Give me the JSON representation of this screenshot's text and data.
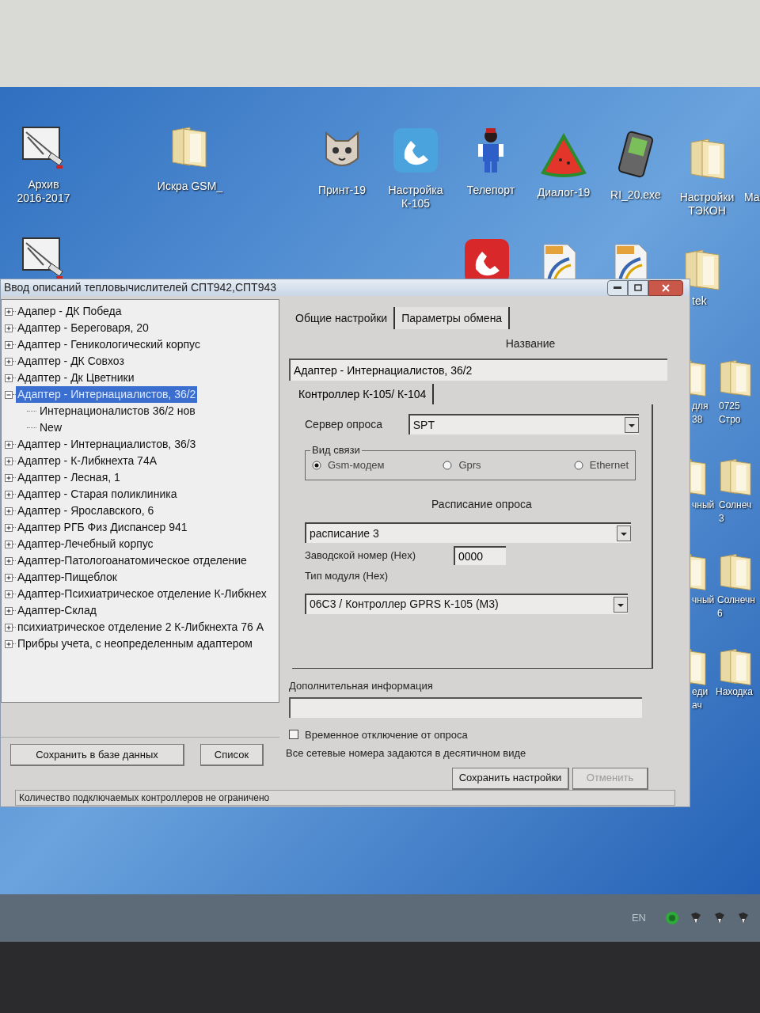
{
  "desktop_icons": [
    {
      "kind": "drawing",
      "label": [
        "Архив",
        "2016-2017"
      ]
    },
    {
      "kind": "folder",
      "label": [
        "Искра GSM_"
      ]
    },
    {
      "kind": "cat",
      "label": [
        "Принт-19"
      ]
    },
    {
      "kind": "phone",
      "label": [
        "Настройка",
        "К-105"
      ]
    },
    {
      "kind": "worker",
      "label": [
        "Телепорт"
      ]
    },
    {
      "kind": "melon",
      "label": [
        "Диалог-19"
      ]
    },
    {
      "kind": "device",
      "label": [
        "RI_20.exe"
      ]
    },
    {
      "kind": "folder",
      "label": [
        "Настройки",
        "ТЭКОН"
      ]
    },
    {
      "kind": "offscreen",
      "label": [
        "Ма"
      ]
    },
    {
      "kind": "drawing"
    },
    {
      "kind": "phone_red"
    },
    {
      "kind": "pdf"
    },
    {
      "kind": "pdf"
    },
    {
      "kind": "folder",
      "label": [
        "tek"
      ]
    },
    {
      "kind": "folder",
      "label": [
        "для",
        "38"
      ]
    },
    {
      "kind": "folder",
      "label": [
        "0725",
        "Стро"
      ]
    },
    {
      "kind": "folder",
      "label": [
        "чный"
      ]
    },
    {
      "kind": "folder",
      "label": [
        "Солнеч",
        "3"
      ]
    },
    {
      "kind": "folder",
      "label": [
        "чный"
      ]
    },
    {
      "kind": "folder",
      "label": [
        "Солнечн",
        "6"
      ]
    },
    {
      "kind": "folder",
      "label": [
        "еди",
        "ач"
      ]
    },
    {
      "kind": "folder",
      "label": [
        "Находка"
      ]
    }
  ],
  "window": {
    "title": "Ввод описаний тепловычислителей СПТ942,СПТ943",
    "tree": [
      {
        "label": "Адапер  - ДК Победа",
        "expanded": false,
        "selected": false
      },
      {
        "label": "Адаптер - Береговаря, 20",
        "expanded": false,
        "selected": false
      },
      {
        "label": "Адаптер - Геникологический корпус",
        "expanded": false,
        "selected": false
      },
      {
        "label": "Адаптер - ДК Совхоз",
        "expanded": false,
        "selected": false
      },
      {
        "label": "Адаптер - Дк Цветники",
        "expanded": false,
        "selected": false
      },
      {
        "label": "Адаптер - Интернациалистов, 36/2",
        "expanded": true,
        "selected": true,
        "children": [
          {
            "label": "Интернационалистов 36/2 нов",
            "selected": false
          },
          {
            "label": "New",
            "selected": false
          }
        ]
      },
      {
        "label": "Адаптер - Интернациалистов, 36/3",
        "expanded": false,
        "selected": false
      },
      {
        "label": "Адаптер - К-Либкнехта 74А",
        "expanded": false,
        "selected": false
      },
      {
        "label": "Адаптер - Лесная, 1",
        "expanded": false,
        "selected": false
      },
      {
        "label": "Адаптер - Старая поликлиника",
        "expanded": false,
        "selected": false
      },
      {
        "label": "Адаптер - Ярославского, 6",
        "expanded": false,
        "selected": false
      },
      {
        "label": "Адаптер РГБ Физ Диспансер 941",
        "expanded": false,
        "selected": false
      },
      {
        "label": "Адаптер-Лечебный корпус",
        "expanded": false,
        "selected": false
      },
      {
        "label": "Адаптер-Патологоанатомическое отделение",
        "expanded": false,
        "selected": false
      },
      {
        "label": "Адаптер-Пищеблок",
        "expanded": false,
        "selected": false
      },
      {
        "label": "Адаптер-Психиатрическое отделение К-Либкнех",
        "expanded": false,
        "selected": false
      },
      {
        "label": "Адаптер-Склад",
        "expanded": false,
        "selected": false
      },
      {
        "label": "психиатрическое отделение 2 К-Либкнехта 76 А",
        "expanded": false,
        "selected": false
      },
      {
        "label": "Прибры учета, с неопределенным адаптером",
        "expanded": false,
        "selected": false
      }
    ],
    "left_buttons": [
      {
        "label": "Сохранить в базе данных",
        "disabled": false
      },
      {
        "label": "Список",
        "disabled": false
      }
    ],
    "tabs": [
      {
        "label": "Общие настройки",
        "selected": true
      },
      {
        "label": "Параметры обмена",
        "selected": false
      }
    ],
    "name_label": "Название",
    "name_value": "Адаптер - Интернациалистов, 36/2",
    "inner_tab": {
      "label": "Контроллер К-105/ К-104",
      "selected": true
    },
    "server_label": "Сервер опроса",
    "server_value": "SPT",
    "link_group": {
      "title": "Вид связи",
      "options": [
        {
          "label": "Gsm-модем",
          "selected": true
        },
        {
          "label": "Gprs",
          "selected": false
        },
        {
          "label": "Ethernet",
          "selected": false
        }
      ]
    },
    "schedule_label": "Расписание  опроса",
    "schedule_value": "расписание 3",
    "serial_label": "Заводской номер (Hex)",
    "serial_value": "0000",
    "module_label": "Тип модуля (Hex)",
    "module_value": "06С3 / Контроллер GPRS К-105 (М3)",
    "extra_label": "Дополнительная информация",
    "disable_poll": {
      "label": "Временное отключение  от опроса",
      "checked": false
    },
    "note": "Все сетевые номера задаются в десятичном виде",
    "right_buttons": [
      {
        "label": "Сохранить настройки",
        "disabled": false
      },
      {
        "label": "Отменить",
        "disabled": true
      }
    ],
    "status": "Количество подключаемых контроллеров не ограничено"
  },
  "taskbar": {
    "language": "EN"
  }
}
